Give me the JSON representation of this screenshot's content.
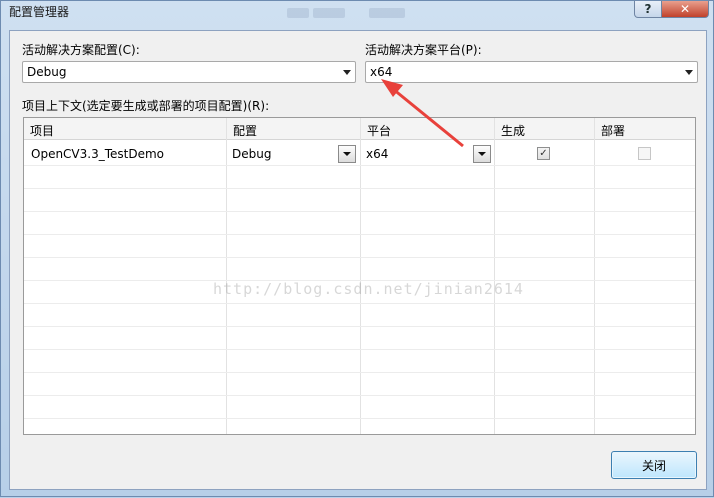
{
  "window": {
    "title": "配置管理器",
    "help_label": "?",
    "close_label": "✕"
  },
  "solution": {
    "config_label": "活动解决方案配置(C):",
    "config_value": "Debug",
    "platform_label": "活动解决方案平台(P):",
    "platform_value": "x64"
  },
  "grid": {
    "caption": "项目上下文(选定要生成或部署的项目配置)(R):",
    "columns": [
      "项目",
      "配置",
      "平台",
      "生成",
      "部署"
    ],
    "rows": [
      {
        "project": "OpenCV3.3_TestDemo",
        "config": "Debug",
        "platform": "x64",
        "build": true,
        "deploy": false
      }
    ]
  },
  "watermark": "http://blog.csdn.net/jinian2614",
  "footer": {
    "close_button": "关闭"
  },
  "colors": {
    "annotation_arrow": "#e8413b"
  }
}
